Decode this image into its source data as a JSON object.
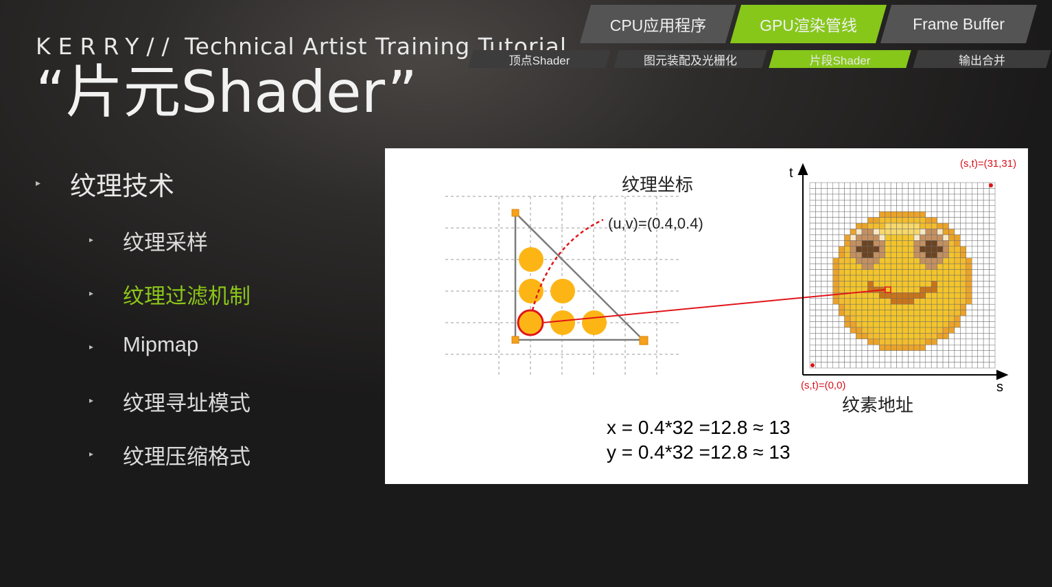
{
  "header": {
    "brand": "KERRY//",
    "brand_rest": " Technical Artist Training Tutorial",
    "title": "“片元Shader”"
  },
  "pipeline": {
    "top_tabs": [
      {
        "label": "CPU应用程序",
        "active": false
      },
      {
        "label": "GPU渲染管线",
        "active": true
      },
      {
        "label": "Frame Buffer",
        "active": false
      }
    ],
    "sub_tabs": [
      {
        "label": "顶点Shader",
        "active": false
      },
      {
        "label": "图元装配及光栅化",
        "active": false
      },
      {
        "label": "片段Shader",
        "active": true
      },
      {
        "label": "输出合并",
        "active": false
      }
    ],
    "active_color": "#86c71a"
  },
  "outline": {
    "main": "纹理技术",
    "items": [
      {
        "label": "纹理采样",
        "active": false
      },
      {
        "label": "纹理过滤机制",
        "active": true
      },
      {
        "label": "Mipmap",
        "active": false
      },
      {
        "label": "纹理寻址模式",
        "active": false
      },
      {
        "label": "纹理压缩格式",
        "active": false
      }
    ]
  },
  "diagram": {
    "uv_title": "纹理坐标",
    "uv_label": "(u,v)=(0.4,0.4)",
    "texel_title": "纹素地址",
    "axis_t": "t",
    "axis_s": "s",
    "corner_top": "(s,t)=(31,31)",
    "corner_bottom": "(s,t)=(0,0)",
    "formula_x": "x = 0.4*32 =12.8 ≈ 13",
    "formula_y": "y = 0.4*32 =12.8 ≈ 13",
    "texture_size": 32,
    "sample_uv": [
      0.4,
      0.4
    ],
    "sample_texel": [
      13,
      13
    ],
    "colors": {
      "fragment": "#fdb515",
      "highlight": "#e0141a",
      "vertex": "#f5a11c",
      "face": "#f3c52b"
    }
  }
}
